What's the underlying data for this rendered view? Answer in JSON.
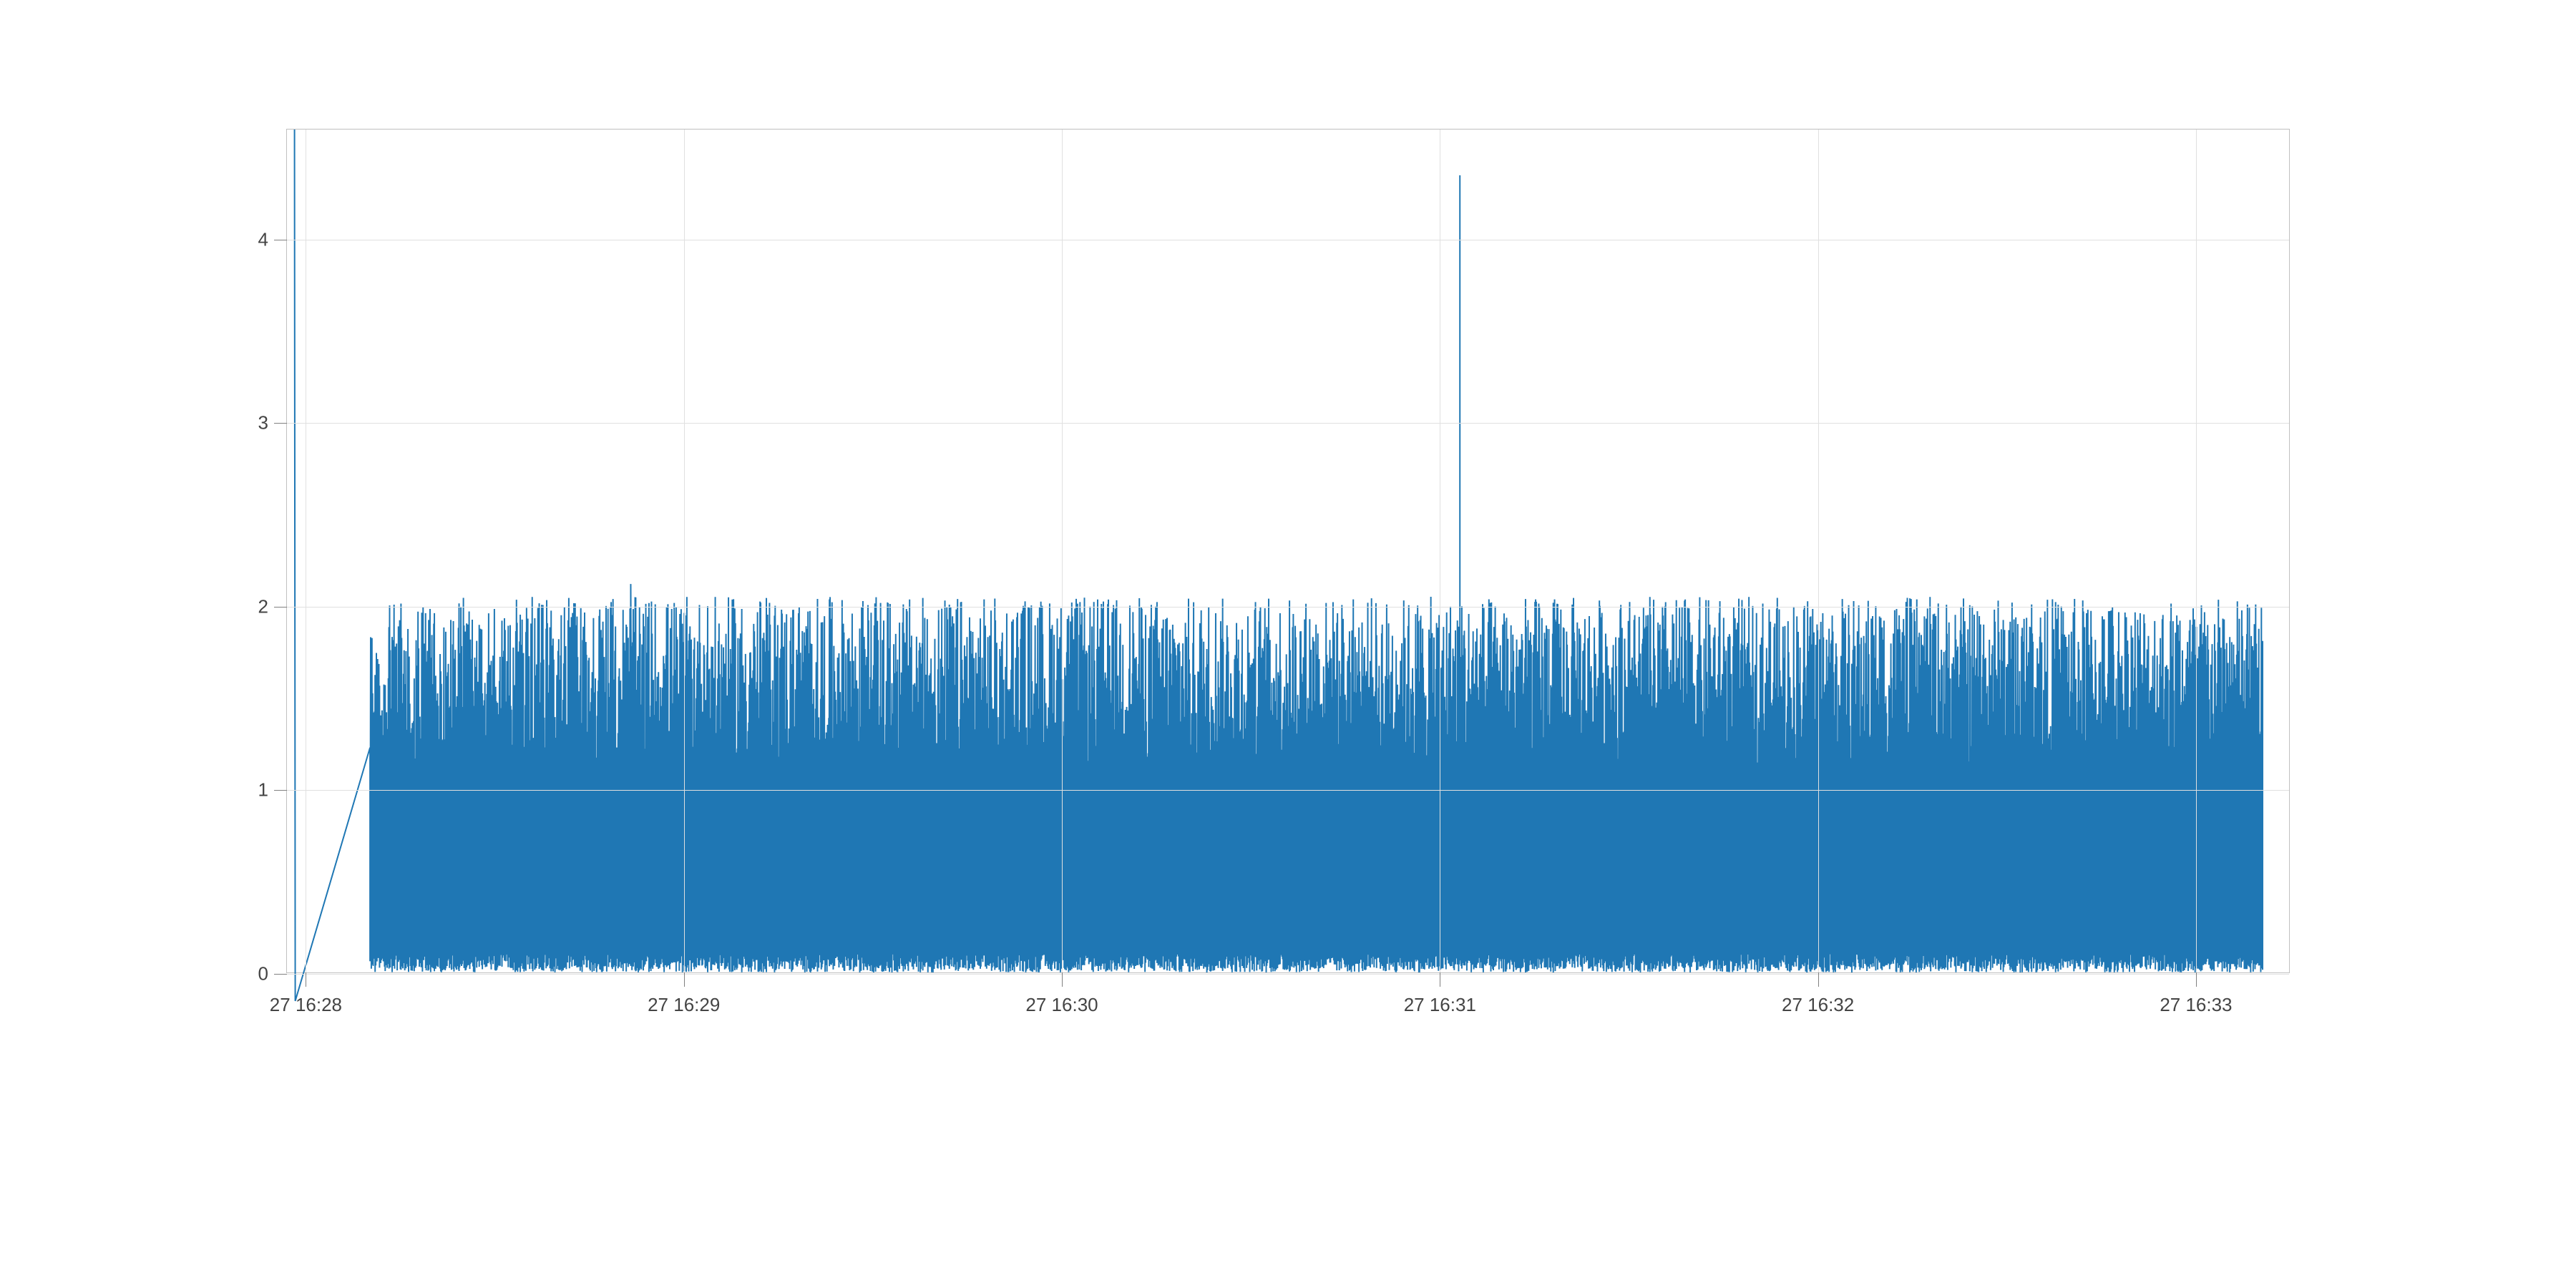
{
  "chart_data": {
    "type": "line",
    "title": "",
    "xlabel": "",
    "ylabel": "",
    "ylim": [
      0,
      4.6
    ],
    "x_tick_labels": [
      "27 16:28",
      "27 16:29",
      "27 16:30",
      "27 16:31",
      "27 16:32",
      "27 16:33"
    ],
    "x_tick_positions_minutes": [
      28,
      29,
      30,
      31,
      32,
      33
    ],
    "x_range_minutes": [
      27.95,
      33.25
    ],
    "y_tick_labels": [
      "0",
      "1",
      "2",
      "3",
      "4"
    ],
    "y_tick_positions": [
      0,
      1,
      2,
      3,
      4
    ],
    "series": [
      {
        "name": "series-0",
        "color": "#1f77b4",
        "description": "Dense noisy time-series that starts near x=28.17; values oscillate rapidly between ~0 and ~2 for the entire span. There is one isolated initial spike at the very left edge reaching ~4.5, and one outlier spike near x≈31.05 reaching ~4.35. Baseline peaks commonly reach 1.5–2.05; troughs reach ~0.",
        "representative_points": [
          {
            "x_min": 27.95,
            "y": 4.5
          },
          {
            "x_min": 28.17,
            "y": 1.7
          },
          {
            "x_min": 28.3,
            "y": 0.1
          },
          {
            "x_min": 28.45,
            "y": 1.9
          },
          {
            "x_min": 28.6,
            "y": 0.2
          },
          {
            "x_min": 28.86,
            "y": 2.1
          },
          {
            "x_min": 29.1,
            "y": 0.05
          },
          {
            "x_min": 29.35,
            "y": 2.03
          },
          {
            "x_min": 29.6,
            "y": 0.1
          },
          {
            "x_min": 29.85,
            "y": 2.05
          },
          {
            "x_min": 30.1,
            "y": 0.0
          },
          {
            "x_min": 30.35,
            "y": 2.0
          },
          {
            "x_min": 30.6,
            "y": 0.05
          },
          {
            "x_min": 30.85,
            "y": 2.0
          },
          {
            "x_min": 31.05,
            "y": 4.35
          },
          {
            "x_min": 31.07,
            "y": 0.1
          },
          {
            "x_min": 31.3,
            "y": 1.85
          },
          {
            "x_min": 31.55,
            "y": 0.0
          },
          {
            "x_min": 31.8,
            "y": 1.95
          },
          {
            "x_min": 32.05,
            "y": 0.05
          },
          {
            "x_min": 32.3,
            "y": 1.95
          },
          {
            "x_min": 32.55,
            "y": 0.0
          },
          {
            "x_min": 32.8,
            "y": 2.0
          },
          {
            "x_min": 33.0,
            "y": 0.05
          },
          {
            "x_min": 33.15,
            "y": 1.7
          }
        ]
      }
    ],
    "noise_model": {
      "n_samples": 3000,
      "x_start_min": 28.17,
      "x_end_min": 33.18,
      "low": 0.0,
      "high_base": 2.05,
      "outliers": [
        {
          "x_min": 27.97,
          "y": 4.5
        },
        {
          "x_min": 28.86,
          "y": 2.12
        },
        {
          "x_min": 31.055,
          "y": 4.35
        }
      ]
    }
  }
}
